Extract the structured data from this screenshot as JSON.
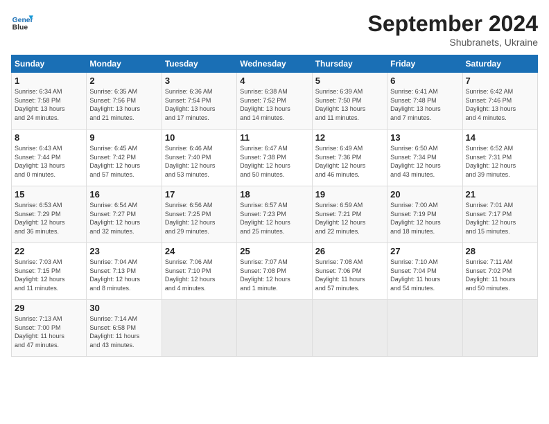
{
  "header": {
    "logo_line1": "General",
    "logo_line2": "Blue",
    "month": "September 2024",
    "location": "Shubranets, Ukraine"
  },
  "days_of_week": [
    "Sunday",
    "Monday",
    "Tuesday",
    "Wednesday",
    "Thursday",
    "Friday",
    "Saturday"
  ],
  "weeks": [
    [
      {
        "day": "1",
        "info": "Sunrise: 6:34 AM\nSunset: 7:58 PM\nDaylight: 13 hours\nand 24 minutes."
      },
      {
        "day": "2",
        "info": "Sunrise: 6:35 AM\nSunset: 7:56 PM\nDaylight: 13 hours\nand 21 minutes."
      },
      {
        "day": "3",
        "info": "Sunrise: 6:36 AM\nSunset: 7:54 PM\nDaylight: 13 hours\nand 17 minutes."
      },
      {
        "day": "4",
        "info": "Sunrise: 6:38 AM\nSunset: 7:52 PM\nDaylight: 13 hours\nand 14 minutes."
      },
      {
        "day": "5",
        "info": "Sunrise: 6:39 AM\nSunset: 7:50 PM\nDaylight: 13 hours\nand 11 minutes."
      },
      {
        "day": "6",
        "info": "Sunrise: 6:41 AM\nSunset: 7:48 PM\nDaylight: 13 hours\nand 7 minutes."
      },
      {
        "day": "7",
        "info": "Sunrise: 6:42 AM\nSunset: 7:46 PM\nDaylight: 13 hours\nand 4 minutes."
      }
    ],
    [
      {
        "day": "8",
        "info": "Sunrise: 6:43 AM\nSunset: 7:44 PM\nDaylight: 13 hours\nand 0 minutes."
      },
      {
        "day": "9",
        "info": "Sunrise: 6:45 AM\nSunset: 7:42 PM\nDaylight: 12 hours\nand 57 minutes."
      },
      {
        "day": "10",
        "info": "Sunrise: 6:46 AM\nSunset: 7:40 PM\nDaylight: 12 hours\nand 53 minutes."
      },
      {
        "day": "11",
        "info": "Sunrise: 6:47 AM\nSunset: 7:38 PM\nDaylight: 12 hours\nand 50 minutes."
      },
      {
        "day": "12",
        "info": "Sunrise: 6:49 AM\nSunset: 7:36 PM\nDaylight: 12 hours\nand 46 minutes."
      },
      {
        "day": "13",
        "info": "Sunrise: 6:50 AM\nSunset: 7:34 PM\nDaylight: 12 hours\nand 43 minutes."
      },
      {
        "day": "14",
        "info": "Sunrise: 6:52 AM\nSunset: 7:31 PM\nDaylight: 12 hours\nand 39 minutes."
      }
    ],
    [
      {
        "day": "15",
        "info": "Sunrise: 6:53 AM\nSunset: 7:29 PM\nDaylight: 12 hours\nand 36 minutes."
      },
      {
        "day": "16",
        "info": "Sunrise: 6:54 AM\nSunset: 7:27 PM\nDaylight: 12 hours\nand 32 minutes."
      },
      {
        "day": "17",
        "info": "Sunrise: 6:56 AM\nSunset: 7:25 PM\nDaylight: 12 hours\nand 29 minutes."
      },
      {
        "day": "18",
        "info": "Sunrise: 6:57 AM\nSunset: 7:23 PM\nDaylight: 12 hours\nand 25 minutes."
      },
      {
        "day": "19",
        "info": "Sunrise: 6:59 AM\nSunset: 7:21 PM\nDaylight: 12 hours\nand 22 minutes."
      },
      {
        "day": "20",
        "info": "Sunrise: 7:00 AM\nSunset: 7:19 PM\nDaylight: 12 hours\nand 18 minutes."
      },
      {
        "day": "21",
        "info": "Sunrise: 7:01 AM\nSunset: 7:17 PM\nDaylight: 12 hours\nand 15 minutes."
      }
    ],
    [
      {
        "day": "22",
        "info": "Sunrise: 7:03 AM\nSunset: 7:15 PM\nDaylight: 12 hours\nand 11 minutes."
      },
      {
        "day": "23",
        "info": "Sunrise: 7:04 AM\nSunset: 7:13 PM\nDaylight: 12 hours\nand 8 minutes."
      },
      {
        "day": "24",
        "info": "Sunrise: 7:06 AM\nSunset: 7:10 PM\nDaylight: 12 hours\nand 4 minutes."
      },
      {
        "day": "25",
        "info": "Sunrise: 7:07 AM\nSunset: 7:08 PM\nDaylight: 12 hours\nand 1 minute."
      },
      {
        "day": "26",
        "info": "Sunrise: 7:08 AM\nSunset: 7:06 PM\nDaylight: 11 hours\nand 57 minutes."
      },
      {
        "day": "27",
        "info": "Sunrise: 7:10 AM\nSunset: 7:04 PM\nDaylight: 11 hours\nand 54 minutes."
      },
      {
        "day": "28",
        "info": "Sunrise: 7:11 AM\nSunset: 7:02 PM\nDaylight: 11 hours\nand 50 minutes."
      }
    ],
    [
      {
        "day": "29",
        "info": "Sunrise: 7:13 AM\nSunset: 7:00 PM\nDaylight: 11 hours\nand 47 minutes."
      },
      {
        "day": "30",
        "info": "Sunrise: 7:14 AM\nSunset: 6:58 PM\nDaylight: 11 hours\nand 43 minutes."
      },
      {
        "day": "",
        "info": ""
      },
      {
        "day": "",
        "info": ""
      },
      {
        "day": "",
        "info": ""
      },
      {
        "day": "",
        "info": ""
      },
      {
        "day": "",
        "info": ""
      }
    ]
  ]
}
